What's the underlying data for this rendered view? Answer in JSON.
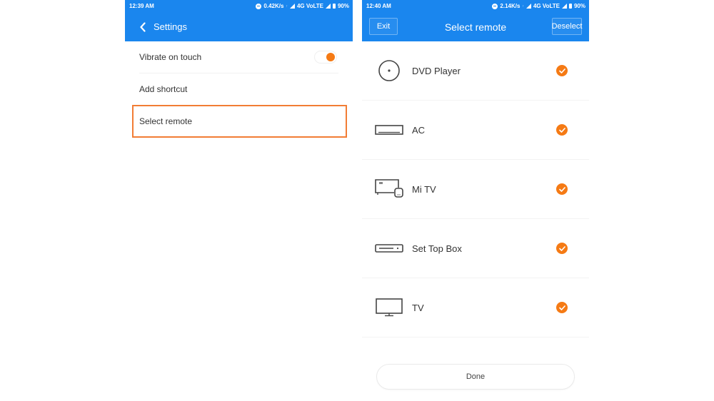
{
  "colors": {
    "accent_blue": "#1a86ee",
    "accent_orange": "#f57a14",
    "highlight_border": "#f27d35"
  },
  "left_screen": {
    "status": {
      "time": "12:39 AM",
      "net_speed": "0.42K/s",
      "network": "4G VoLTE",
      "battery": "90%",
      "dnd_icon": "dnd-icon",
      "signal_icon": "signal-icon",
      "battery_icon": "battery-icon"
    },
    "appbar": {
      "back_icon": "chevron-left-icon",
      "title": "Settings"
    },
    "settings": [
      {
        "label": "Vibrate on touch",
        "toggle": true,
        "toggle_on": true
      },
      {
        "label": "Add shortcut"
      },
      {
        "label": "Select remote",
        "highlighted": true
      }
    ]
  },
  "right_screen": {
    "status": {
      "time": "12:40 AM",
      "net_speed": "2.14K/s",
      "network": "4G VoLTE",
      "battery": "90%"
    },
    "appbar": {
      "exit_label": "Exit",
      "title": "Select remote",
      "deselect_label": "Deselect"
    },
    "remotes": [
      {
        "label": "DVD Player",
        "icon": "dvd-player-icon",
        "selected": true
      },
      {
        "label": "AC",
        "icon": "ac-icon",
        "selected": true
      },
      {
        "label": "Mi TV",
        "icon": "mi-tv-icon",
        "selected": true
      },
      {
        "label": "Set Top Box",
        "icon": "set-top-box-icon",
        "selected": true
      },
      {
        "label": "TV",
        "icon": "tv-icon",
        "selected": true
      }
    ],
    "done_label": "Done"
  }
}
